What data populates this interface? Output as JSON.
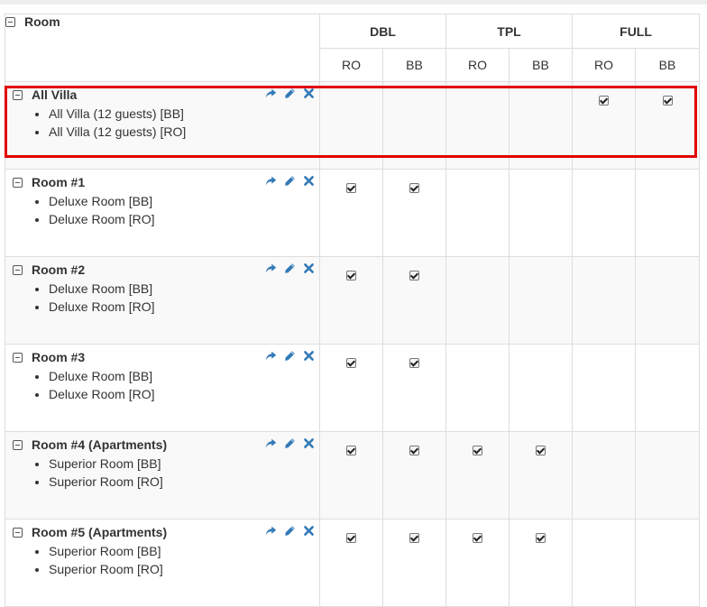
{
  "header": {
    "room_label": "Room",
    "groups": [
      "DBL",
      "TPL",
      "FULL"
    ],
    "subcolumns": [
      "RO",
      "BB",
      "RO",
      "BB",
      "RO",
      "BB"
    ]
  },
  "accent_color": "#337ab7",
  "highlight_color": "#e00000",
  "rows": [
    {
      "name": "All Villa",
      "rates": [
        "All Villa (12 guests) [BB]",
        "All Villa (12 guests) [RO]"
      ],
      "checks": [
        false,
        false,
        false,
        false,
        true,
        true
      ]
    },
    {
      "name": "Room #1",
      "rates": [
        "Deluxe Room [BB]",
        "Deluxe Room [RO]"
      ],
      "checks": [
        true,
        true,
        false,
        false,
        false,
        false
      ]
    },
    {
      "name": "Room #2",
      "rates": [
        "Deluxe Room [BB]",
        "Deluxe Room [RO]"
      ],
      "checks": [
        true,
        true,
        false,
        false,
        false,
        false
      ]
    },
    {
      "name": "Room #3",
      "rates": [
        "Deluxe Room [BB]",
        "Deluxe Room [RO]"
      ],
      "checks": [
        true,
        true,
        false,
        false,
        false,
        false
      ]
    },
    {
      "name": "Room #4 (Apartments)",
      "rates": [
        "Superior Room [BB]",
        "Superior Room [RO]"
      ],
      "checks": [
        true,
        true,
        true,
        true,
        false,
        false
      ]
    },
    {
      "name": "Room #5 (Apartments)",
      "rates": [
        "Superior Room [BB]",
        "Superior Room [RO]"
      ],
      "checks": [
        true,
        true,
        true,
        true,
        false,
        false
      ]
    }
  ]
}
